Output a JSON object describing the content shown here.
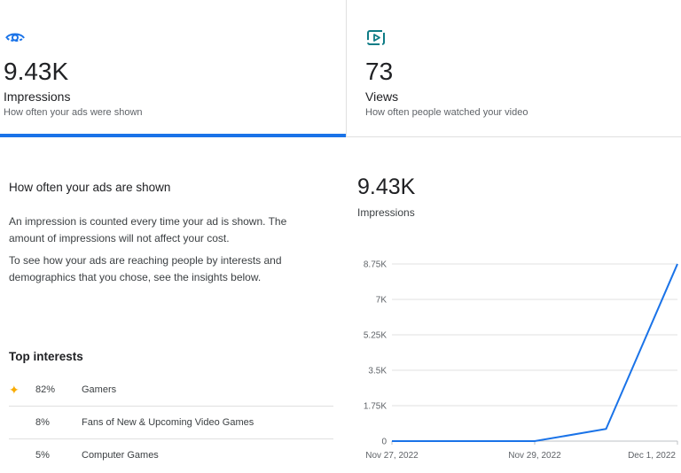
{
  "metrics": {
    "impressions": {
      "value": "9.43K",
      "label": "Impressions",
      "description": "How often your ads were shown",
      "icon": "eye-icon",
      "selected": true
    },
    "views": {
      "value": "73",
      "label": "Views",
      "description": "How often people watched your video",
      "icon": "video-play-icon"
    }
  },
  "info": {
    "heading": "How often your ads are shown",
    "paragraph1": "An impression is counted every time your ad is shown. The amount of impressions will not affect your cost.",
    "paragraph2": "To see how your ads are reaching people by interests and demographics that you chose, see the insights below."
  },
  "top_interests": {
    "heading": "Top interests",
    "items": [
      {
        "percent": "82%",
        "name": "Gamers",
        "icon": "sparkle-icon"
      },
      {
        "percent": "8%",
        "name": "Fans of New & Upcoming Video Games"
      },
      {
        "percent": "5%",
        "name": "Computer Games"
      }
    ]
  },
  "chart_summary": {
    "value": "9.43K",
    "label": "Impressions"
  },
  "colors": {
    "accent": "#1a73e8",
    "sparkle": "#f9ab00",
    "icon_teal": "#0e7c86"
  },
  "chart_data": {
    "type": "line",
    "x": [
      "Nov 27, 2022",
      "Nov 28, 2022",
      "Nov 29, 2022",
      "Nov 30, 2022",
      "Dec 1, 2022"
    ],
    "series": [
      {
        "values": [
          0,
          0,
          0,
          600,
          8750
        ]
      }
    ],
    "x_tick_labels": [
      "Nov 27, 2022",
      "Nov 29, 2022",
      "Dec 1, 2022"
    ],
    "y_ticks": [
      0,
      1750,
      3500,
      5250,
      7000,
      8750
    ],
    "y_tick_labels": [
      "0",
      "1.75K",
      "3.5K",
      "5.25K",
      "7K",
      "8.75K"
    ],
    "ylim": [
      0,
      8750
    ],
    "grid": true
  }
}
